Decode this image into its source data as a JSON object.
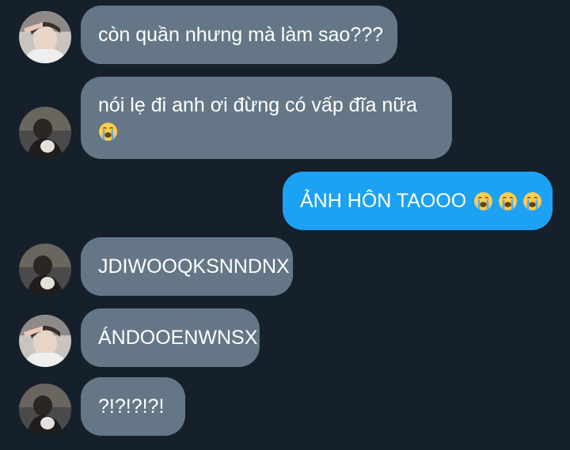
{
  "conversation": {
    "messages": [
      {
        "sender": "other-gray-hoodie",
        "direction": "incoming",
        "text": "còn quần nhưng mà làm sao???"
      },
      {
        "sender": "other-dark-photo",
        "direction": "incoming",
        "text_line1": "nói lẹ đi anh ơi đừng có vấp đĩa nữa",
        "emoji": [
          "loudly-crying-face"
        ]
      },
      {
        "sender": "me",
        "direction": "outgoing",
        "text": "ẢNH HÔN TAOOO",
        "emoji": [
          "loudly-crying-face",
          "loudly-crying-face",
          "loudly-crying-face"
        ]
      },
      {
        "sender": "other-dark-photo",
        "direction": "incoming",
        "text": "JDIWOOQKSNNDNX"
      },
      {
        "sender": "other-gray-hoodie",
        "direction": "incoming",
        "text": "ÁNDOOENWNSX"
      },
      {
        "sender": "other-dark-photo",
        "direction": "incoming",
        "text": "?!?!?!?!"
      }
    ]
  },
  "colors": {
    "background": "#15202b",
    "incoming_bubble": "#657786",
    "outgoing_bubble": "#1da1f2",
    "text": "#ffffff"
  }
}
